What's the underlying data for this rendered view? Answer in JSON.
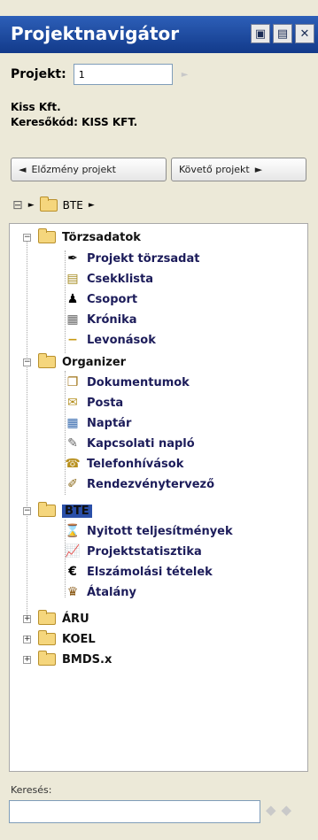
{
  "window": {
    "title": "Projektnavigátor"
  },
  "project": {
    "label": "Projekt:",
    "value": "1",
    "company": "Kiss Kft.",
    "searchcode": "Keresőkód: KISS KFT."
  },
  "nav": {
    "prev": "Előzmény projekt",
    "next": "Követő projekt"
  },
  "breadcrumb": {
    "folder": "BTE"
  },
  "tree": {
    "torzsadatok": "Törzsadatok",
    "items_torzs": [
      "Projekt törzsadat",
      "Csekklista",
      "Csoport",
      "Krónika",
      "Levonások"
    ],
    "organizer": "Organizer",
    "items_org": [
      "Dokumentumok",
      "Posta",
      "Naptár",
      "Kapcsolati napló",
      "Telefonhívások",
      "Rendezvénytervező"
    ],
    "bte": "BTE",
    "items_bte": [
      "Nyitott teljesítmények",
      "Projektstatisztika",
      "Elszámolási tételek",
      "Átalány"
    ],
    "others": [
      "ÁRU",
      "KOEL",
      "BMDS.x"
    ]
  },
  "search": {
    "label": "Keresés:",
    "value": ""
  }
}
